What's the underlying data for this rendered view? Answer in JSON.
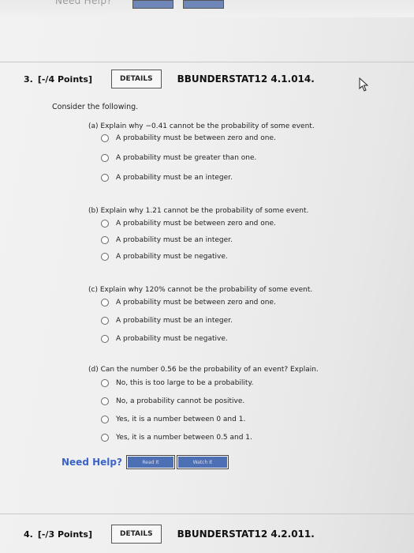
{
  "top_strip": {
    "ghost_text": "Need Help?"
  },
  "question3": {
    "number": "3.",
    "points": "[-/4 Points]",
    "details_label": "DETAILS",
    "code": "BBUNDERSTAT12 4.1.014.",
    "intro": "Consider the following.",
    "parts": [
      {
        "prompt": "(a) Explain why −0.41 cannot be the probability of some event.",
        "options": [
          "A probability must be between zero and one.",
          "A probability must be greater than one.",
          "A probability must be an integer."
        ]
      },
      {
        "prompt": "(b) Explain why 1.21 cannot be the probability of some event.",
        "options": [
          "A probability must be between zero and one.",
          "A probability must be an integer.",
          "A probability must be negative."
        ]
      },
      {
        "prompt": "(c) Explain why 120% cannot be the probability of some event.",
        "options": [
          "A probability must be between zero and one.",
          "A probability must be an integer.",
          "A probability must be negative."
        ]
      },
      {
        "prompt": "(d) Can the number 0.56 be the probability of an event? Explain.",
        "options": [
          "No, this is too large to be a probability.",
          "No, a probability cannot be positive.",
          "Yes, it is a number between 0 and 1.",
          "Yes, it is a number between 0.5 and 1."
        ]
      }
    ],
    "help": {
      "label": "Need Help?",
      "read_it": "Read It",
      "watch_it": "Watch It"
    }
  },
  "question4": {
    "number": "4.",
    "points": "[-/3 Points]",
    "details_label": "DETAILS",
    "code": "BBUNDERSTAT12 4.2.011."
  },
  "colors": {
    "help_blue": "#3b63c8",
    "button_blue": "#4d6fb3"
  },
  "icons": [
    "mouse-pointer-icon",
    "radio-icon"
  ]
}
